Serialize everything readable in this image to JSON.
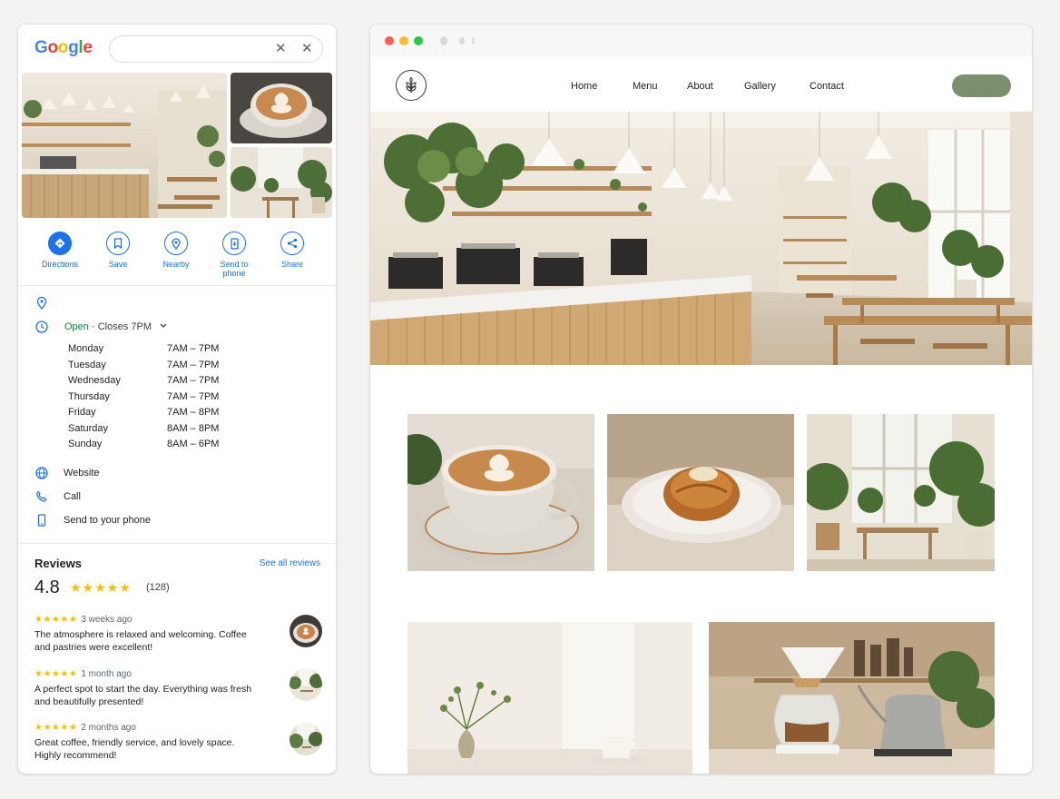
{
  "maps": {
    "logo": {
      "letters": [
        "G",
        "o",
        "o",
        "g",
        "l",
        "e"
      ],
      "colors": [
        "#4285F4",
        "#EA4335",
        "#FBBC05",
        "#4285F4",
        "#34A853",
        "#EA4335"
      ]
    },
    "search": {
      "value": "",
      "clear_icon": "close-icon",
      "close_icon": "close-icon"
    },
    "actions": [
      {
        "label": "Directions",
        "icon": "directions-icon"
      },
      {
        "label": "Save",
        "icon": "bookmark-icon"
      },
      {
        "label": "Nearby",
        "icon": "nearby-icon"
      },
      {
        "label": "Send to phone",
        "icon": "phone-icon"
      },
      {
        "label": "Share",
        "icon": "share-icon"
      }
    ],
    "status": {
      "open": "Open",
      "closes": " · Closes 7PM"
    },
    "hours": [
      {
        "day": "Monday",
        "time": "7AM – 7PM"
      },
      {
        "day": "Tuesday",
        "time": "7AM – 7PM"
      },
      {
        "day": "Wednesday",
        "time": "7AM – 7PM"
      },
      {
        "day": "Thursday",
        "time": "7AM – 7PM"
      },
      {
        "day": "Friday",
        "time": "7AM – 8PM"
      },
      {
        "day": "Saturday",
        "time": "8AM – 8PM"
      },
      {
        "day": "Sunday",
        "time": "8AM – 6PM"
      }
    ],
    "links": {
      "website": "Website",
      "call": "Call",
      "send": "Send to your phone"
    },
    "reviews": {
      "title": "Reviews",
      "see_all": "See all reviews",
      "rating": "4.8",
      "stars": "★★★★★",
      "count": "(128)",
      "items": [
        {
          "stars": "★★★★★",
          "ago": "3 weeks ago",
          "text": "The atmosphere is relaxed and welcoming. Coffee and pastries were excellent!"
        },
        {
          "stars": "★★★★★",
          "ago": "1 month ago",
          "text": "A perfect spot to start the day. Everything was fresh and beautifully presented!"
        },
        {
          "stars": "★★★★★",
          "ago": "2 months ago",
          "text": "Great coffee, friendly service, and lovely space. Highly recommend!"
        }
      ]
    },
    "accent": "#1a73e8",
    "open_color": "#188038",
    "star_color": "#fbbc04"
  },
  "site": {
    "nav": [
      "Home",
      "Menu",
      "About",
      "Gallery",
      "Contact"
    ],
    "cta_color": "#7d8f6e",
    "logo_icon": "leaf-icon",
    "window_dots": [
      "#ff5f57",
      "#febc2e",
      "#28c840"
    ]
  }
}
